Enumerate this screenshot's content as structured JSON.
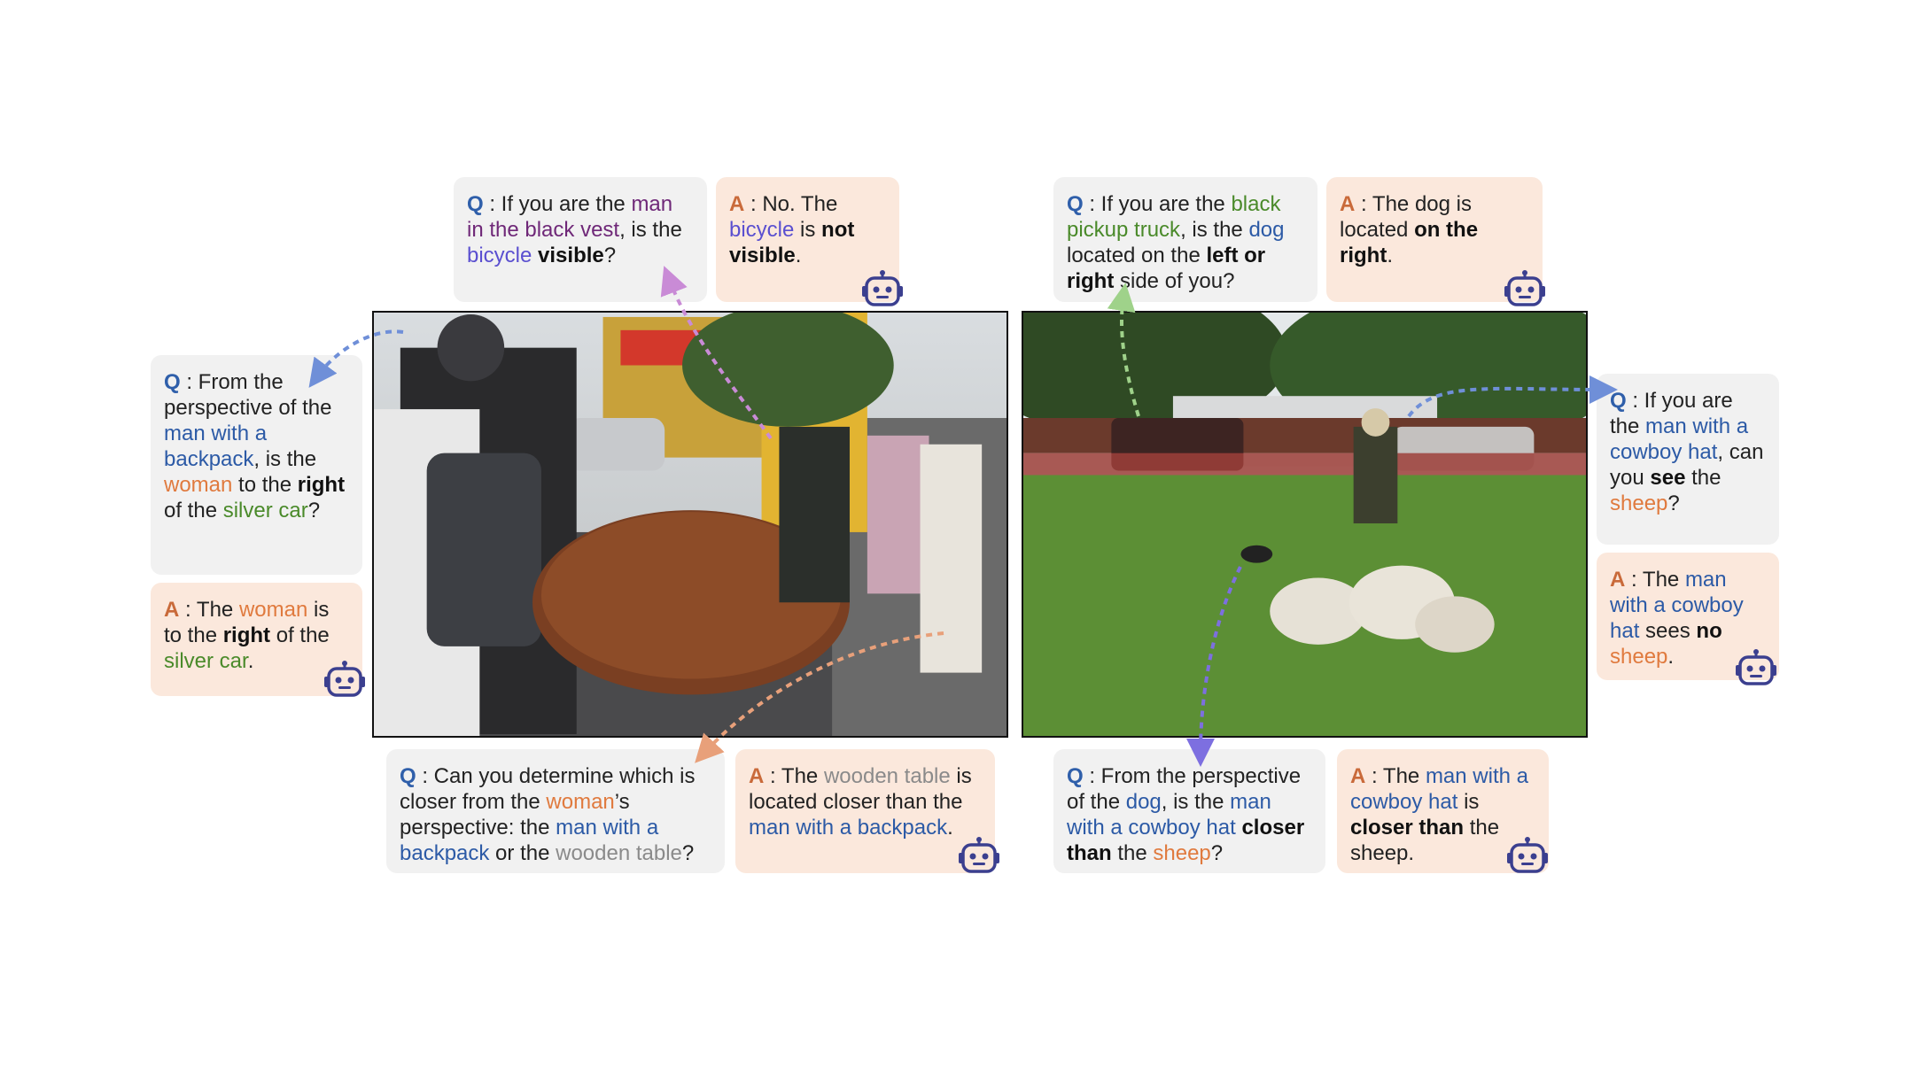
{
  "colors": {
    "question_bg": "#f1f1f1",
    "answer_bg": "#fbe8dc",
    "q_label": "#2f5faa",
    "a_label": "#c96a3a",
    "blue": "#2c5aa6",
    "orange": "#e07a3e",
    "green": "#4a8a2a",
    "purple": "#6f2878",
    "violet": "#5a4fd0",
    "arrow_blue": "#6f8fd8",
    "arrow_pink": "#c98bd6",
    "arrow_orange": "#e8a07a",
    "arrow_green": "#9fd28a",
    "arrow_violet": "#7d6fe0"
  },
  "images": [
    {
      "icon": "street-scene-photo"
    },
    {
      "icon": "sheep-field-photo"
    }
  ],
  "cards": [
    {
      "id": "left-top-q",
      "type": "q",
      "label": "Q",
      "segments": [
        {
          "text": " : If you are the ",
          "style": ""
        },
        {
          "text": "man in the black vest",
          "style": "hl-purple"
        },
        {
          "text": ", is the ",
          "style": ""
        },
        {
          "text": "bicycle",
          "style": "hl-violet"
        },
        {
          "text": " ",
          "style": ""
        },
        {
          "text": "visible",
          "style": "bold"
        },
        {
          "text": "?",
          "style": ""
        }
      ]
    },
    {
      "id": "left-top-a",
      "type": "a",
      "label": "A",
      "segments": [
        {
          "text": " : No. The ",
          "style": ""
        },
        {
          "text": "bicycle",
          "style": "hl-violet"
        },
        {
          "text": " is ",
          "style": ""
        },
        {
          "text": "not visible",
          "style": "bold"
        },
        {
          "text": ".",
          "style": ""
        }
      ]
    },
    {
      "id": "left-side-q",
      "type": "q",
      "label": "Q",
      "segments": [
        {
          "text": " : From the perspective of the ",
          "style": ""
        },
        {
          "text": "man with a backpack",
          "style": "hl-blue"
        },
        {
          "text": ", is the ",
          "style": ""
        },
        {
          "text": "woman",
          "style": "hl-orange"
        },
        {
          "text": " to the ",
          "style": ""
        },
        {
          "text": "right",
          "style": "bold"
        },
        {
          "text": " of the ",
          "style": ""
        },
        {
          "text": "silver car",
          "style": "hl-green"
        },
        {
          "text": "?",
          "style": ""
        }
      ]
    },
    {
      "id": "left-side-a",
      "type": "a",
      "label": "A",
      "segments": [
        {
          "text": " : The ",
          "style": ""
        },
        {
          "text": "woman",
          "style": "hl-orange"
        },
        {
          "text": " is to the ",
          "style": ""
        },
        {
          "text": "right",
          "style": "bold"
        },
        {
          "text": " of the ",
          "style": ""
        },
        {
          "text": "silver car",
          "style": "hl-green"
        },
        {
          "text": ".",
          "style": ""
        }
      ]
    },
    {
      "id": "left-bottom-q",
      "type": "q",
      "label": "Q",
      "segments": [
        {
          "text": " : Can you determine which is closer from the ",
          "style": ""
        },
        {
          "text": "woman",
          "style": "hl-orange"
        },
        {
          "text": "’s perspective: the ",
          "style": ""
        },
        {
          "text": "man with a backpack",
          "style": "hl-blue"
        },
        {
          "text": " or the ",
          "style": ""
        },
        {
          "text": "wooden table",
          "style": "hl-gray"
        },
        {
          "text": "?",
          "style": ""
        }
      ]
    },
    {
      "id": "left-bottom-a",
      "type": "a",
      "label": "A",
      "segments": [
        {
          "text": " : The ",
          "style": ""
        },
        {
          "text": "wooden table",
          "style": "hl-gray"
        },
        {
          "text": " is located closer than the ",
          "style": ""
        },
        {
          "text": "man with a backpack",
          "style": "hl-blue"
        },
        {
          "text": ".",
          "style": ""
        }
      ]
    },
    {
      "id": "right-top-q",
      "type": "q",
      "label": "Q",
      "segments": [
        {
          "text": " : If you are the ",
          "style": ""
        },
        {
          "text": "black pickup truck",
          "style": "hl-green"
        },
        {
          "text": ", is the ",
          "style": ""
        },
        {
          "text": "dog",
          "style": "hl-blue"
        },
        {
          "text": " located on the ",
          "style": ""
        },
        {
          "text": "left or right",
          "style": "bold"
        },
        {
          "text": " side of you?",
          "style": ""
        }
      ]
    },
    {
      "id": "right-top-a",
      "type": "a",
      "label": "A",
      "segments": [
        {
          "text": " : The dog is located ",
          "style": ""
        },
        {
          "text": "on the right",
          "style": "bold"
        },
        {
          "text": ".",
          "style": ""
        }
      ]
    },
    {
      "id": "right-side-q",
      "type": "q",
      "label": "Q",
      "segments": [
        {
          "text": " : If you are the ",
          "style": ""
        },
        {
          "text": "man with a cowboy hat",
          "style": "hl-blue"
        },
        {
          "text": ", can you ",
          "style": ""
        },
        {
          "text": "see",
          "style": "bold"
        },
        {
          "text": " the ",
          "style": ""
        },
        {
          "text": "sheep",
          "style": "hl-orange"
        },
        {
          "text": "?",
          "style": ""
        }
      ]
    },
    {
      "id": "right-side-a",
      "type": "a",
      "label": "A",
      "segments": [
        {
          "text": " : The ",
          "style": ""
        },
        {
          "text": "man with a cowboy hat",
          "style": "hl-blue"
        },
        {
          "text": " sees ",
          "style": ""
        },
        {
          "text": "no",
          "style": "bold"
        },
        {
          "text": " ",
          "style": ""
        },
        {
          "text": "sheep",
          "style": "hl-orange"
        },
        {
          "text": ".",
          "style": ""
        }
      ]
    },
    {
      "id": "right-bottom-q",
      "type": "q",
      "label": "Q",
      "segments": [
        {
          "text": " : From the perspective of the ",
          "style": ""
        },
        {
          "text": "dog",
          "style": "hl-blue"
        },
        {
          "text": ", is the ",
          "style": ""
        },
        {
          "text": "man with a cowboy hat",
          "style": "hl-blue"
        },
        {
          "text": " ",
          "style": ""
        },
        {
          "text": "closer than",
          "style": "bold"
        },
        {
          "text": " the ",
          "style": ""
        },
        {
          "text": "sheep",
          "style": "hl-orange"
        },
        {
          "text": "?",
          "style": ""
        }
      ]
    },
    {
      "id": "right-bottom-a",
      "type": "a",
      "label": "A",
      "segments": [
        {
          "text": " : The ",
          "style": ""
        },
        {
          "text": "man with a cowboy hat",
          "style": "hl-blue"
        },
        {
          "text": " is ",
          "style": ""
        },
        {
          "text": "closer than",
          "style": "bold"
        },
        {
          "text": " the sheep.",
          "style": ""
        }
      ]
    }
  ]
}
